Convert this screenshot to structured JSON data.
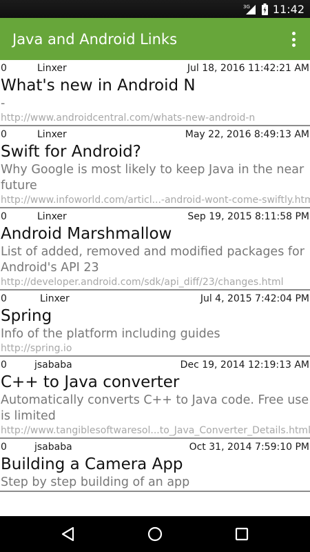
{
  "status": {
    "network": "3G",
    "time": "11:42"
  },
  "app_bar": {
    "title": "Java and Android Links"
  },
  "links": [
    {
      "count": "0",
      "author": "Linxer",
      "date": "Jul 18, 2016 11:42:21 AM",
      "title": "What's new in Android N",
      "description": "-",
      "url": "http://www.androidcentral.com/whats-new-android-n"
    },
    {
      "count": "0",
      "author": "Linxer",
      "date": "May 22, 2016 8:49:13 AM",
      "title": "Swift for Android?",
      "description": "Why Google is most likely to keep Java in the near future",
      "url": "http://www.infoworld.com/articl...-android-wont-come-swiftly.html"
    },
    {
      "count": "0",
      "author": "Linxer",
      "date": "Sep 19, 2015 8:11:58 PM",
      "title": "Android Marshmallow",
      "description": "List of added, removed and modified packages for Android's API 23",
      "url": "http://developer.android.com/sdk/api_diff/23/changes.html"
    },
    {
      "count": "0",
      "author": "Linxer",
      "date": "Jul 4, 2015 7:42:04 PM",
      "title": "Spring",
      "description": "Info of the platform including guides",
      "url": "http://spring.io"
    },
    {
      "count": "0",
      "author": "jsababa",
      "date": "Dec 19, 2014 12:19:13 AM",
      "title": "C++ to Java converter",
      "description": "Automatically converts C++ to Java code. Free use is limited",
      "url": "http://www.tangiblesoftwaresol...to_Java_Converter_Details.html"
    },
    {
      "count": "0",
      "author": "jsababa",
      "date": "Oct 31, 2014 7:59:10 PM",
      "title": "Building a Camera App",
      "description": "Step by step building of an app",
      "url": ""
    }
  ]
}
